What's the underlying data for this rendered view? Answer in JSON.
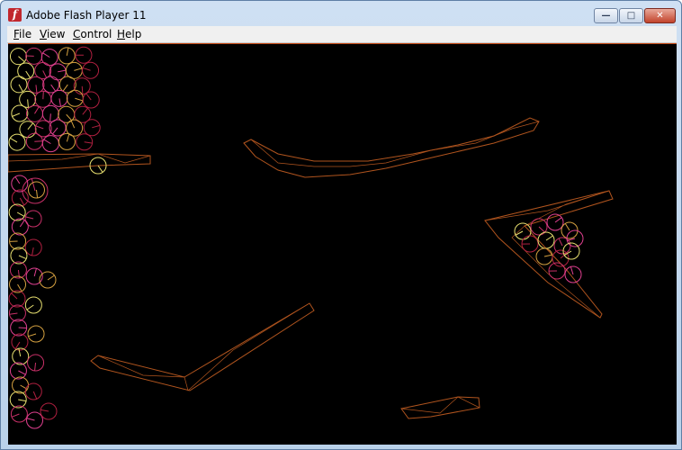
{
  "window": {
    "title": "Adobe Flash Player 11",
    "app_icon_glyph": "f",
    "controls": {
      "minimize_glyph": "—",
      "maximize_glyph": "□",
      "close_glyph": "✕"
    }
  },
  "menu": {
    "file": {
      "accel": "F",
      "rest": "ile"
    },
    "view": {
      "accel": "V",
      "rest": "iew"
    },
    "control": {
      "accel": "C",
      "rest": "ontrol"
    },
    "help": {
      "accel": "H",
      "rest": "elp"
    }
  },
  "colors": {
    "stage_background": "#000000",
    "platform_stroke": "#b0541e",
    "ball_colors": [
      "#e8e070",
      "#c83068",
      "#e04090",
      "#d4a040",
      "#b02040"
    ]
  },
  "icons": {
    "app": "flash-player-icon",
    "minimize": "minimize-icon",
    "maximize": "maximize-icon",
    "close": "close-icon"
  }
}
